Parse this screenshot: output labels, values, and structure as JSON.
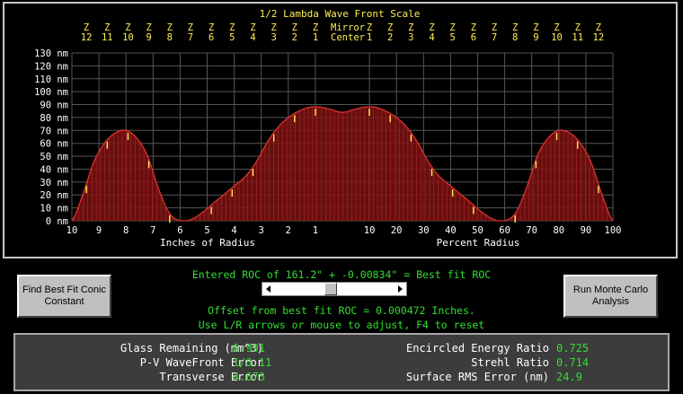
{
  "chart_data": {
    "type": "area",
    "title": "1/2 Lambda Wave Front Scale",
    "zone_labels_left": [
      "12",
      "11",
      "10",
      "9",
      "8",
      "7",
      "6",
      "5",
      "4",
      "3",
      "2",
      "1"
    ],
    "zone_labels_right": [
      "1",
      "2",
      "3",
      "4",
      "5",
      "6",
      "7",
      "8",
      "9",
      "10",
      "11",
      "12"
    ],
    "zone_prefix": "Z",
    "center_label_top": "Mirror",
    "center_label_bottom": "Center",
    "y_ticks": [
      "0 nm",
      "10 nm",
      "20 nm",
      "30 nm",
      "40 nm",
      "50 nm",
      "60 nm",
      "70 nm",
      "80 nm",
      "90 nm",
      "100 nm",
      "110 nm",
      "120 nm",
      "130 nm"
    ],
    "ylim": [
      0,
      130
    ],
    "x_ticks_left": [
      "10",
      "9",
      "8",
      "7",
      "6",
      "5",
      "4",
      "3",
      "2",
      "1"
    ],
    "x_ticks_right": [
      "10",
      "20",
      "30",
      "40",
      "50",
      "60",
      "70",
      "80",
      "90",
      "100"
    ],
    "xlabel_left": "Inches of Radius",
    "xlabel_right": "Percent Radius",
    "curve_x": [
      -100,
      -96,
      -92,
      -88,
      -84,
      -80,
      -76,
      -72,
      -68,
      -64,
      -60,
      -56,
      -52,
      -48,
      -44,
      -40,
      -36,
      -32,
      -28,
      -24,
      -20,
      -16,
      -12,
      -8,
      -4,
      0,
      4,
      8,
      12,
      16,
      20,
      24,
      28,
      32,
      36,
      40,
      44,
      48,
      52,
      56,
      60,
      64,
      68,
      72,
      76,
      80,
      84,
      88,
      92,
      96,
      100
    ],
    "curve_y": [
      0,
      20,
      45,
      60,
      68,
      70,
      64,
      50,
      25,
      6,
      0,
      1,
      6,
      13,
      20,
      27,
      34,
      45,
      60,
      72,
      80,
      85,
      88,
      88,
      86,
      84,
      86,
      88,
      88,
      85,
      80,
      72,
      60,
      45,
      34,
      27,
      20,
      13,
      6,
      1,
      0,
      6,
      25,
      50,
      64,
      70,
      68,
      60,
      45,
      20,
      0
    ],
    "grid": true,
    "colors": {
      "fill": "#7a1010",
      "curve": "#e03030",
      "stripes": "#c03030",
      "grid": "#555555",
      "axis_text": "#ffffff",
      "zone_text": "#ffee55",
      "zone_tick": "#ffee55"
    }
  },
  "roc": {
    "text": "Entered ROC of 161.2\" + -0.00834\" = Best fit ROC"
  },
  "slider": {
    "value_fraction": 0.47
  },
  "offset": {
    "text": "Offset from best fit ROC = 0.000472 Inches."
  },
  "help": {
    "text": "Use L/R arrows or mouse to adjust, F4 to reset"
  },
  "buttons": {
    "conic": "Find Best Fit Conic\nConstant",
    "monte": "Run Monte Carlo\nAnalysis"
  },
  "stats": {
    "glass_label": "Glass Remaining (mm^3)",
    "glass_value": "6.991",
    "pv_label": "P-V WaveFront Error",
    "pv_value": "1/3.11",
    "trans_label": "Transverse Error",
    "trans_value": "4.673",
    "enc_label": "Encircled Energy Ratio",
    "enc_value": "0.725",
    "strehl_label": "Strehl Ratio",
    "strehl_value": "0.714",
    "rms_label": "Surface RMS Error (nm)",
    "rms_value": "24.9"
  }
}
